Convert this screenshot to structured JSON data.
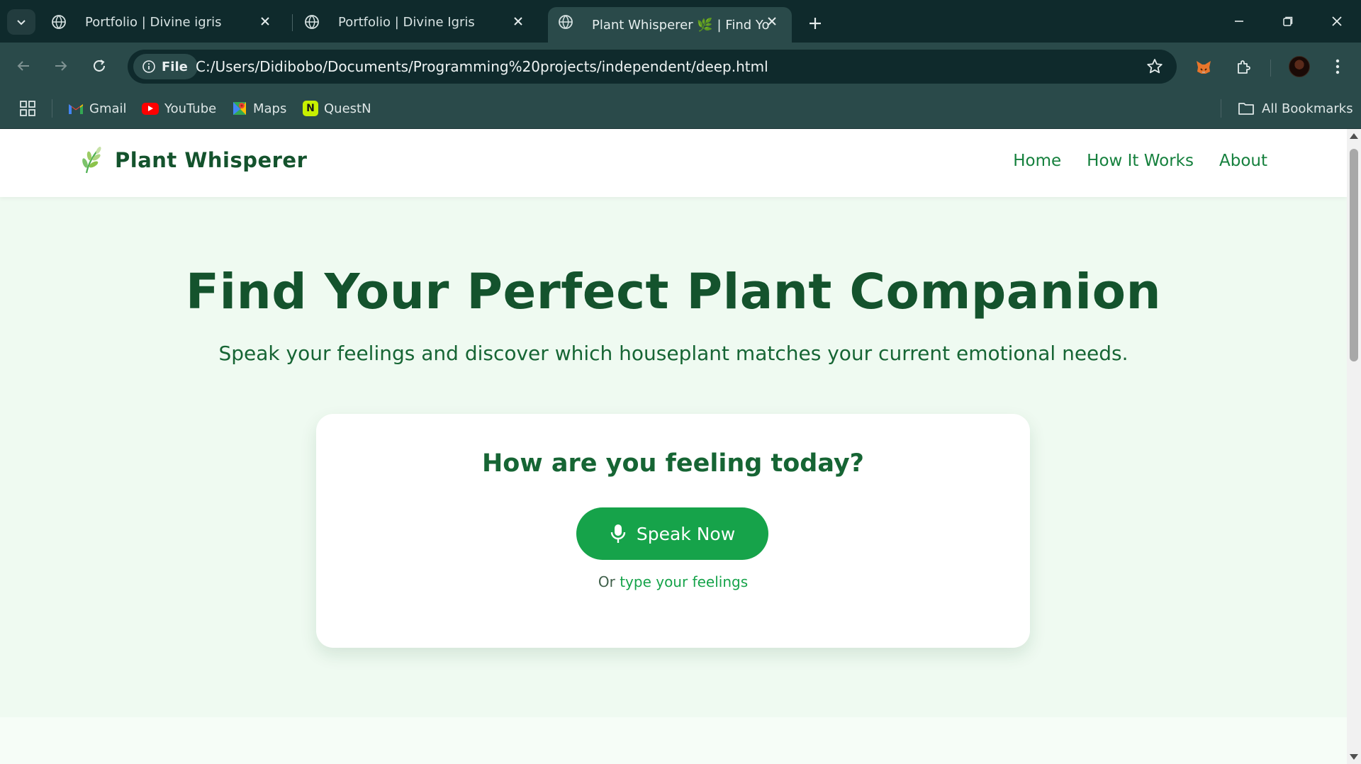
{
  "browser": {
    "tabs": [
      {
        "title": "Portfolio | Divine igris",
        "active": false
      },
      {
        "title": "Portfolio | Divine Igris",
        "active": false
      },
      {
        "title": "Plant Whisperer 🌿 | Find Your",
        "active": true
      }
    ],
    "site_info_label": "File",
    "url": "C:/Users/Didibobo/Documents/Programming%20projects/independent/deep.html",
    "bookmarks": [
      {
        "label": "Gmail",
        "icon": "gmail-icon"
      },
      {
        "label": "YouTube",
        "icon": "youtube-icon"
      },
      {
        "label": "Maps",
        "icon": "maps-icon"
      },
      {
        "label": "QuestN",
        "icon": "questn-icon"
      }
    ],
    "all_bookmarks_label": "All Bookmarks"
  },
  "site": {
    "brand": "Plant Whisperer",
    "nav": {
      "home": "Home",
      "how_it_works": "How It Works",
      "about": "About"
    }
  },
  "hero": {
    "title": "Find Your Perfect Plant Companion",
    "subtitle": "Speak your feelings and discover which houseplant matches your current emotional needs."
  },
  "card": {
    "title": "How are you feeling today?",
    "speak_button": "Speak Now",
    "or_text": "Or",
    "type_link": "type your feelings"
  },
  "colors": {
    "primary_green": "#16a34a",
    "dark_green": "#14532d",
    "page_bg": "#effaf1",
    "chrome_bg": "#0f2a2c",
    "toolbar_bg": "#2a4a4a"
  }
}
